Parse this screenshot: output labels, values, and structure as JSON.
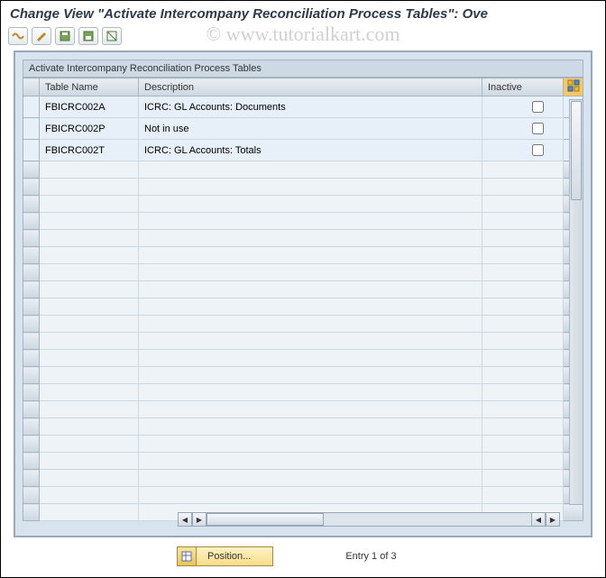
{
  "watermark": "© www.tutorialkart.com",
  "title": "Change View \"Activate Intercompany Reconciliation Process Tables\": Ove",
  "panel_title": "Activate Intercompany Reconciliation Process Tables",
  "columns": {
    "name": "Table Name",
    "desc": "Description",
    "inactive": "Inactive"
  },
  "rows": [
    {
      "name": "FBICRC002A",
      "desc": "ICRC: GL Accounts: Documents",
      "inactive": false
    },
    {
      "name": "FBICRC002P",
      "desc": "Not in use",
      "inactive": false
    },
    {
      "name": "FBICRC002T",
      "desc": "ICRC: GL Accounts: Totals",
      "inactive": false
    }
  ],
  "empty_rows": 21,
  "footer": {
    "position_label": "Position...",
    "entry_text": "Entry 1 of 3"
  },
  "toolbar_icons": [
    "other-view-icon",
    "change-icon",
    "save-icon",
    "select-all-icon",
    "deselect-all-icon"
  ]
}
